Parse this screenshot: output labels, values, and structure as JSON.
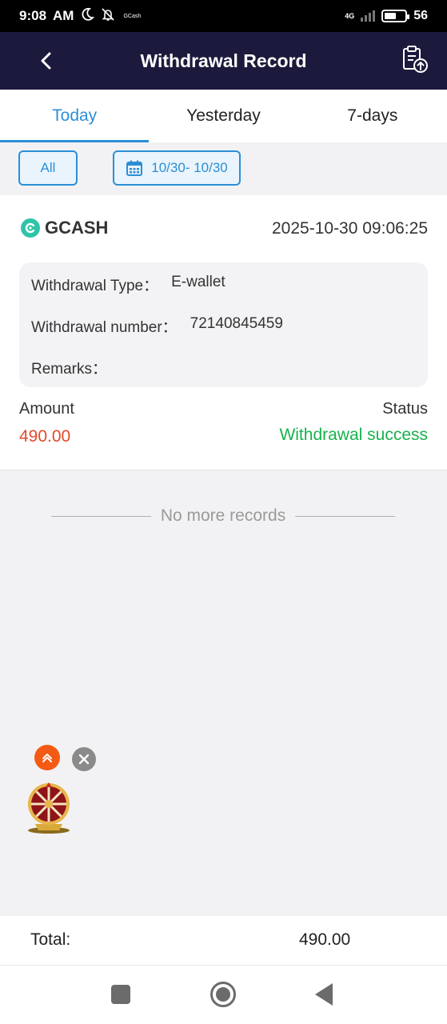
{
  "status_bar": {
    "time": "9:08",
    "am_pm": "AM",
    "notification_app": "GCash",
    "network": "4G",
    "battery": "56"
  },
  "header": {
    "title": "Withdrawal Record"
  },
  "tabs": [
    {
      "label": "Today",
      "active": true
    },
    {
      "label": "Yesterday",
      "active": false
    },
    {
      "label": "7-days",
      "active": false
    }
  ],
  "filters": {
    "type_label": "All",
    "date_range": "10/30- 10/30"
  },
  "record": {
    "method": "GCASH",
    "datetime": "2025-10-30 09:06:25",
    "details": [
      {
        "label": "Withdrawal Type：",
        "value": "E-wallet"
      },
      {
        "label": "Withdrawal number：",
        "value": "72140845459"
      },
      {
        "label": "Remarks：",
        "value": ""
      }
    ],
    "amount_label": "Amount",
    "amount_value": "490.00",
    "status_label": "Status",
    "status_value": "Withdrawal success"
  },
  "list_end": {
    "text": "No more records"
  },
  "total": {
    "label": "Total:",
    "value": "490.00"
  },
  "colors": {
    "header_bg": "#1c1a3c",
    "accent": "#2b8fd6",
    "amount": "#e24a2b",
    "success": "#18b34c"
  }
}
